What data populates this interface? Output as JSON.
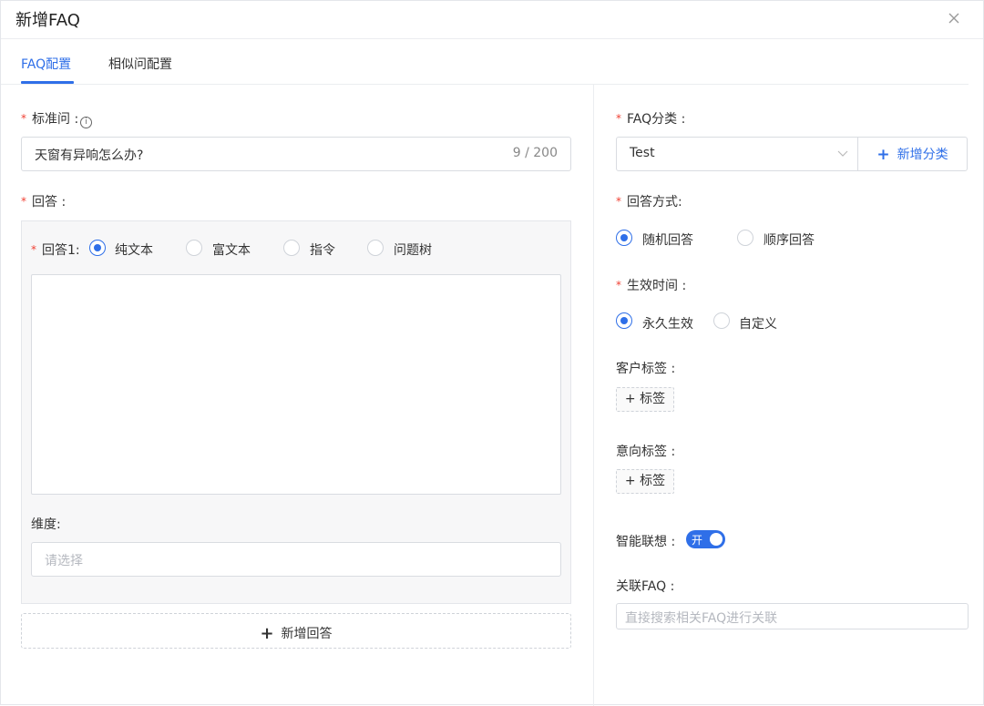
{
  "dialog": {
    "title": "新增FAQ",
    "close_icon": "close-icon"
  },
  "tabs": [
    {
      "label": "FAQ配置",
      "active": true
    },
    {
      "label": "相似问配置",
      "active": false
    }
  ],
  "left": {
    "standard_question": {
      "label": "标准问 :",
      "required": "*",
      "info_icon": "i",
      "value": "天窗有异响怎么办?",
      "counter": "9 / 200"
    },
    "answer": {
      "label": "回答 :",
      "required": "*",
      "item_label": "回答1:",
      "types": [
        "纯文本",
        "富文本",
        "指令",
        "问题树"
      ],
      "selected_type": "纯文本",
      "content": "",
      "dimension_label": "维度:",
      "dimension_placeholder": "请选择"
    },
    "add_answer": {
      "icon": "+",
      "label": "新增回答"
    }
  },
  "right": {
    "category": {
      "label": "FAQ分类 :",
      "required": "*",
      "value": "Test",
      "add_icon": "+",
      "add_label": "新增分类"
    },
    "answer_mode": {
      "label": "回答方式:",
      "required": "*",
      "options": [
        "随机回答",
        "顺序回答"
      ],
      "selected": "随机回答"
    },
    "effective_time": {
      "label": "生效时间 :",
      "required": "*",
      "options": [
        "永久生效",
        "自定义"
      ],
      "selected": "永久生效"
    },
    "customer_tags": {
      "label": "客户标签 :",
      "add_label": "+ 标签"
    },
    "intent_tags": {
      "label": "意向标签 :",
      "add_label": "+ 标签"
    },
    "smart_association": {
      "label": "智能联想 :",
      "switch_text": "开",
      "on": true
    },
    "related_faq": {
      "label": "关联FAQ :",
      "placeholder": "直接搜索相关FAQ进行关联"
    }
  },
  "colors": {
    "accent": "#2f6fe8",
    "required": "#f04134",
    "border": "#d9dce1"
  }
}
